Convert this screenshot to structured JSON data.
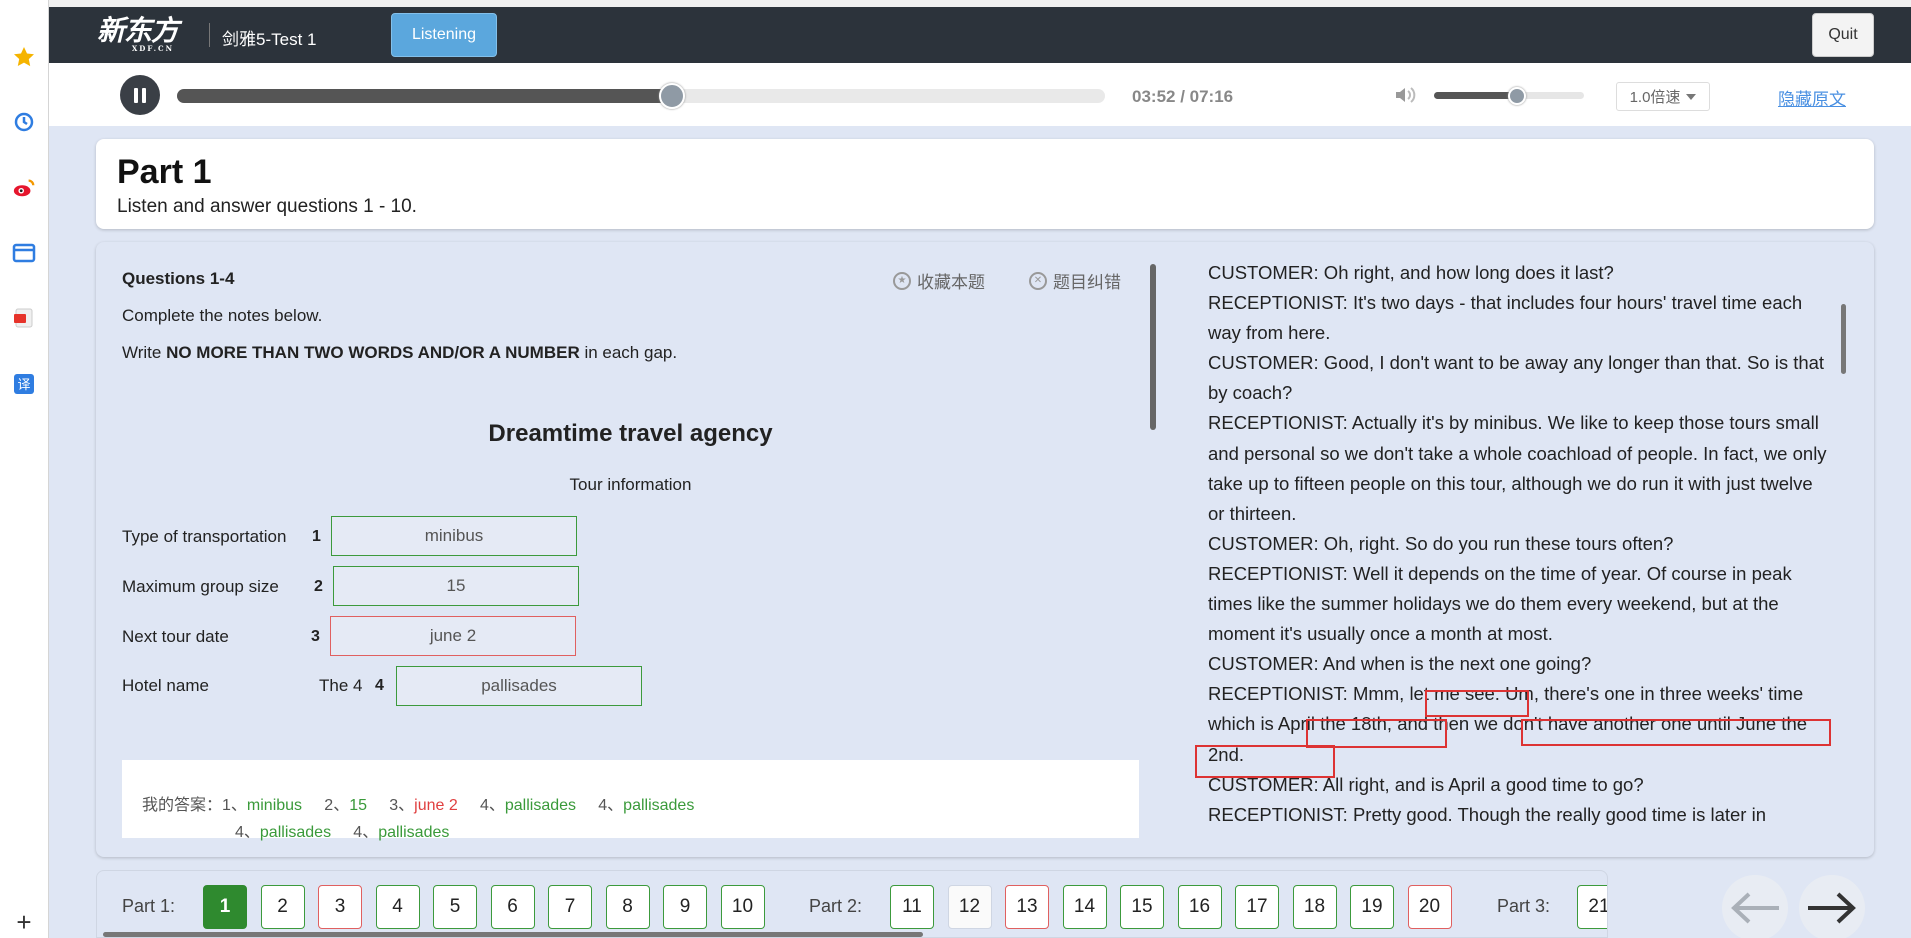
{
  "header": {
    "logo_text": "新东方",
    "logo_sub": "XDF.CN",
    "test_title": "剑雅5-Test 1",
    "tab_label": "Listening",
    "quit_label": "Quit"
  },
  "player": {
    "time": "03:52 / 07:16",
    "progress": 0.533,
    "volume": 0.55,
    "speed_label": "1.0倍速",
    "hide_transcript_label": "隐藏原文"
  },
  "part": {
    "title": "Part 1",
    "instruction": "Listen and answer questions 1 - 10."
  },
  "questions": {
    "heading": "Questions 1-4",
    "favorite_label": "收藏本题",
    "report_label": "题目纠错",
    "instruction1": "Complete the notes below.",
    "instruction2_pre": "Write ",
    "instruction2_bold": "NO MORE THAN TWO WORDS AND/OR A NUMBER",
    "instruction2_post": " in each gap.",
    "notes_title": "Dreamtime travel agency",
    "notes_subtitle": "Tour information",
    "rows": [
      {
        "label": "Type of transportation",
        "prefix": "",
        "num": "1",
        "answer": "minibus"
      },
      {
        "label": "Maximum group size",
        "prefix": "",
        "num": "2",
        "answer": "15"
      },
      {
        "label": "Next tour date",
        "prefix": "",
        "num": "3",
        "answer": "june 2"
      },
      {
        "label": "Hotel name",
        "prefix": "The 4",
        "num": "4",
        "answer": "pallisades"
      }
    ],
    "my_answers_label": "我的答案：",
    "my_answers_line1": [
      {
        "n": "1、",
        "v": "minibus"
      },
      {
        "n": "2、",
        "v": "15"
      },
      {
        "n": "3、",
        "v": "june 2"
      },
      {
        "n": "4、",
        "v": "pallisades"
      },
      {
        "n": "4、",
        "v": "pallisades"
      }
    ],
    "my_answers_line2": [
      {
        "n": "4、",
        "v": "pallisades"
      },
      {
        "n": "4、",
        "v": "pallisades"
      }
    ]
  },
  "transcript": [
    "CUSTOMER: Oh right, and how long does it last?",
    "RECEPTIONIST: It's two days - that includes four hours' travel time each way from here.",
    "CUSTOMER: Good, I don't want to be away any longer than that. So is that by coach?",
    "RECEPTIONIST: Actually it's by minibus. We like to keep those tours small and personal so we don't take a whole coachload of people. In fact, we only take up to fifteen people on this tour, although we do run it with just twelve or thirteen.",
    "CUSTOMER: Oh, right. So do you run these tours often?",
    "RECEPTIONIST: Well it depends on the time of year. Of course in peak times like the summer holidays we do them every weekend, but at the moment it's usually once a month at most.",
    "CUSTOMER: And when is the next one going?",
    "RECEPTIONIST: Mmm, let me see. Um, there's one in three weeks' time which is April the 18th, and then we don't have another one until June the 2nd.",
    "CUSTOMER: All right, and is April a good time to go?",
    "RECEPTIONIST: Pretty good. Though the really good time is later in"
  ],
  "nav": {
    "parts": [
      {
        "label": "Part 1:",
        "questions": [
          "1",
          "2",
          "3",
          "4",
          "5",
          "6",
          "7",
          "8",
          "9",
          "10"
        ]
      },
      {
        "label": "Part 2:",
        "questions": [
          "11",
          "12",
          "13",
          "14",
          "15",
          "16",
          "17",
          "18",
          "19",
          "20"
        ]
      },
      {
        "label": "Part 3:",
        "questions": [
          "21"
        ]
      }
    ],
    "wrong": [
      "3",
      "13",
      "20"
    ],
    "unanswered": [
      "12"
    ],
    "active": "1"
  },
  "colors": {
    "correct": "#3a9a3a",
    "wrong": "#e04040",
    "accent": "#5ba7dd",
    "header_bg": "#2c333b"
  }
}
